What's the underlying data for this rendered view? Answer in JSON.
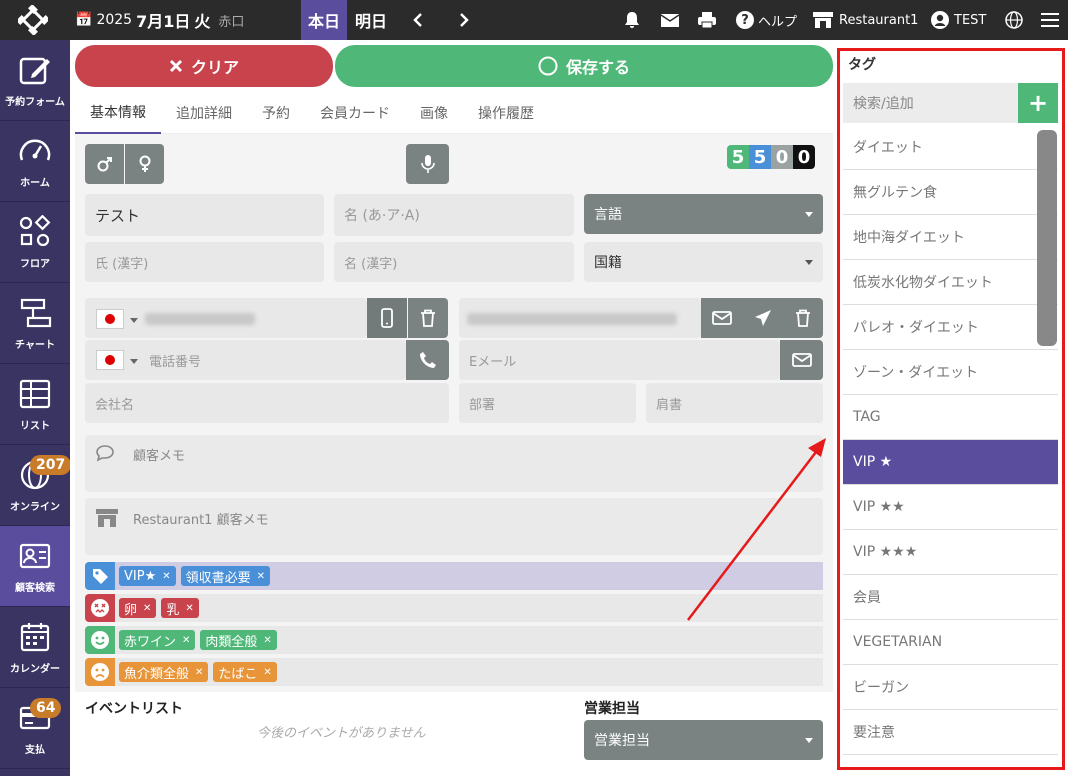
{
  "topbar": {
    "year": "2025",
    "date": "7月1日",
    "weekday": "火",
    "rokuyo": "赤口",
    "today": "本日",
    "tomorrow": "明日",
    "help": "ヘルプ",
    "restaurant": "Restaurant1",
    "user": "TEST"
  },
  "sidebar": {
    "items": [
      {
        "label": "予約フォーム",
        "icon": "edit-icon"
      },
      {
        "label": "ホーム",
        "icon": "dashboard-icon"
      },
      {
        "label": "フロア",
        "icon": "floor-icon"
      },
      {
        "label": "チャート",
        "icon": "chart-icon"
      },
      {
        "label": "リスト",
        "icon": "table-icon"
      },
      {
        "label": "オンライン",
        "icon": "globe-icon",
        "badge": "207"
      },
      {
        "label": "顧客検索",
        "icon": "customer-card-icon"
      },
      {
        "label": "カレンダー",
        "icon": "calendar-icon"
      },
      {
        "label": "支払",
        "icon": "card-icon",
        "badge": "64"
      }
    ]
  },
  "actions": {
    "clear": "クリア",
    "save": "保存する"
  },
  "tabs": [
    "基本情報",
    "追加詳細",
    "予約",
    "会員カード",
    "画像",
    "操作履歴"
  ],
  "counter": [
    "5",
    "5",
    "0",
    "0"
  ],
  "form": {
    "name_value": "テスト",
    "name_kana_placeholder": "名 (あ·ア·A)",
    "language": "言語",
    "last_kanji_placeholder": "氏 (漢字)",
    "first_kanji_placeholder": "名 (漢字)",
    "nationality": "国籍",
    "phone_placeholder": "電話番号",
    "email_placeholder": "Eメール",
    "company_placeholder": "会社名",
    "department_placeholder": "部署",
    "title_placeholder": "肩書",
    "memo_placeholder": "顧客メモ",
    "restaurant_memo_placeholder": "Restaurant1 顧客メモ"
  },
  "tag_rows": [
    {
      "icon": "tag-icon",
      "color": "#4a90d9",
      "chips": [
        "VIP★",
        "領収書必要"
      ]
    },
    {
      "icon": "allergy-icon",
      "color": "#c9434c",
      "chips": [
        "卵",
        "乳"
      ]
    },
    {
      "icon": "smile-icon",
      "color": "#4fb878",
      "chips": [
        "赤ワイン",
        "肉類全般"
      ]
    },
    {
      "icon": "frown-icon",
      "color": "#e8953a",
      "chips": [
        "魚介類全般",
        "たばこ"
      ]
    }
  ],
  "events": {
    "title": "イベントリスト",
    "empty": "今後のイベントがありません"
  },
  "sales": {
    "title": "営業担当",
    "select": "営業担当"
  },
  "tag_panel": {
    "title": "タグ",
    "search_placeholder": "検索/追加",
    "items": [
      "ダイエット",
      "無グルテン食",
      "地中海ダイエット",
      "低炭水化物ダイエット",
      "パレオ・ダイエット",
      "ゾーン・ダイエット",
      "TAG",
      "VIP ★",
      "VIP ★★",
      "VIP ★★★",
      "会員",
      "VEGETARIAN",
      "ビーガン",
      "要注意"
    ],
    "selected": "VIP ★"
  }
}
